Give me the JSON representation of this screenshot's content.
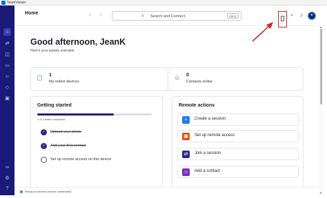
{
  "window": {
    "app_name": "TeamViewer"
  },
  "header": {
    "title": "Home",
    "search_placeholder": "Search and Connect",
    "search_shortcut": "Ctrl+K",
    "avatar_initial": "e"
  },
  "greeting": {
    "title": "Good afternoon, JeanK",
    "subtitle": "Here's your activity overview"
  },
  "stats": [
    {
      "count": "1",
      "label": "My online devices"
    },
    {
      "count": "0",
      "label": "Contacts online"
    }
  ],
  "getting_started": {
    "title": "Getting started",
    "progress_text": "2 of 3 tasks completed",
    "progress_fraction": 0.67,
    "tasks": [
      {
        "label": "Upload your photo",
        "done": true
      },
      {
        "label": "Add your first contact",
        "done": true
      },
      {
        "label": "Set up remote access on this device",
        "done": false
      }
    ]
  },
  "remote_actions": {
    "title": "Remote actions",
    "items": [
      {
        "label": "Create a session",
        "icon": "plus-icon",
        "color": "#1e7be6"
      },
      {
        "label": "Set up remote access",
        "icon": "remote-access-icon",
        "color": "#e0561b"
      },
      {
        "label": "Join a session",
        "icon": "join-icon",
        "color": "#2b2b8c"
      },
      {
        "label": "Add a contact",
        "icon": "add-contact-icon",
        "color": "#7a2fbf"
      }
    ]
  },
  "status": {
    "text": "Ready to connect (secure connection)",
    "color": "#1fa35c"
  },
  "colors": {
    "rail": "#1a1a78",
    "accent": "#1e1e80",
    "highlight": "#d9252a"
  }
}
